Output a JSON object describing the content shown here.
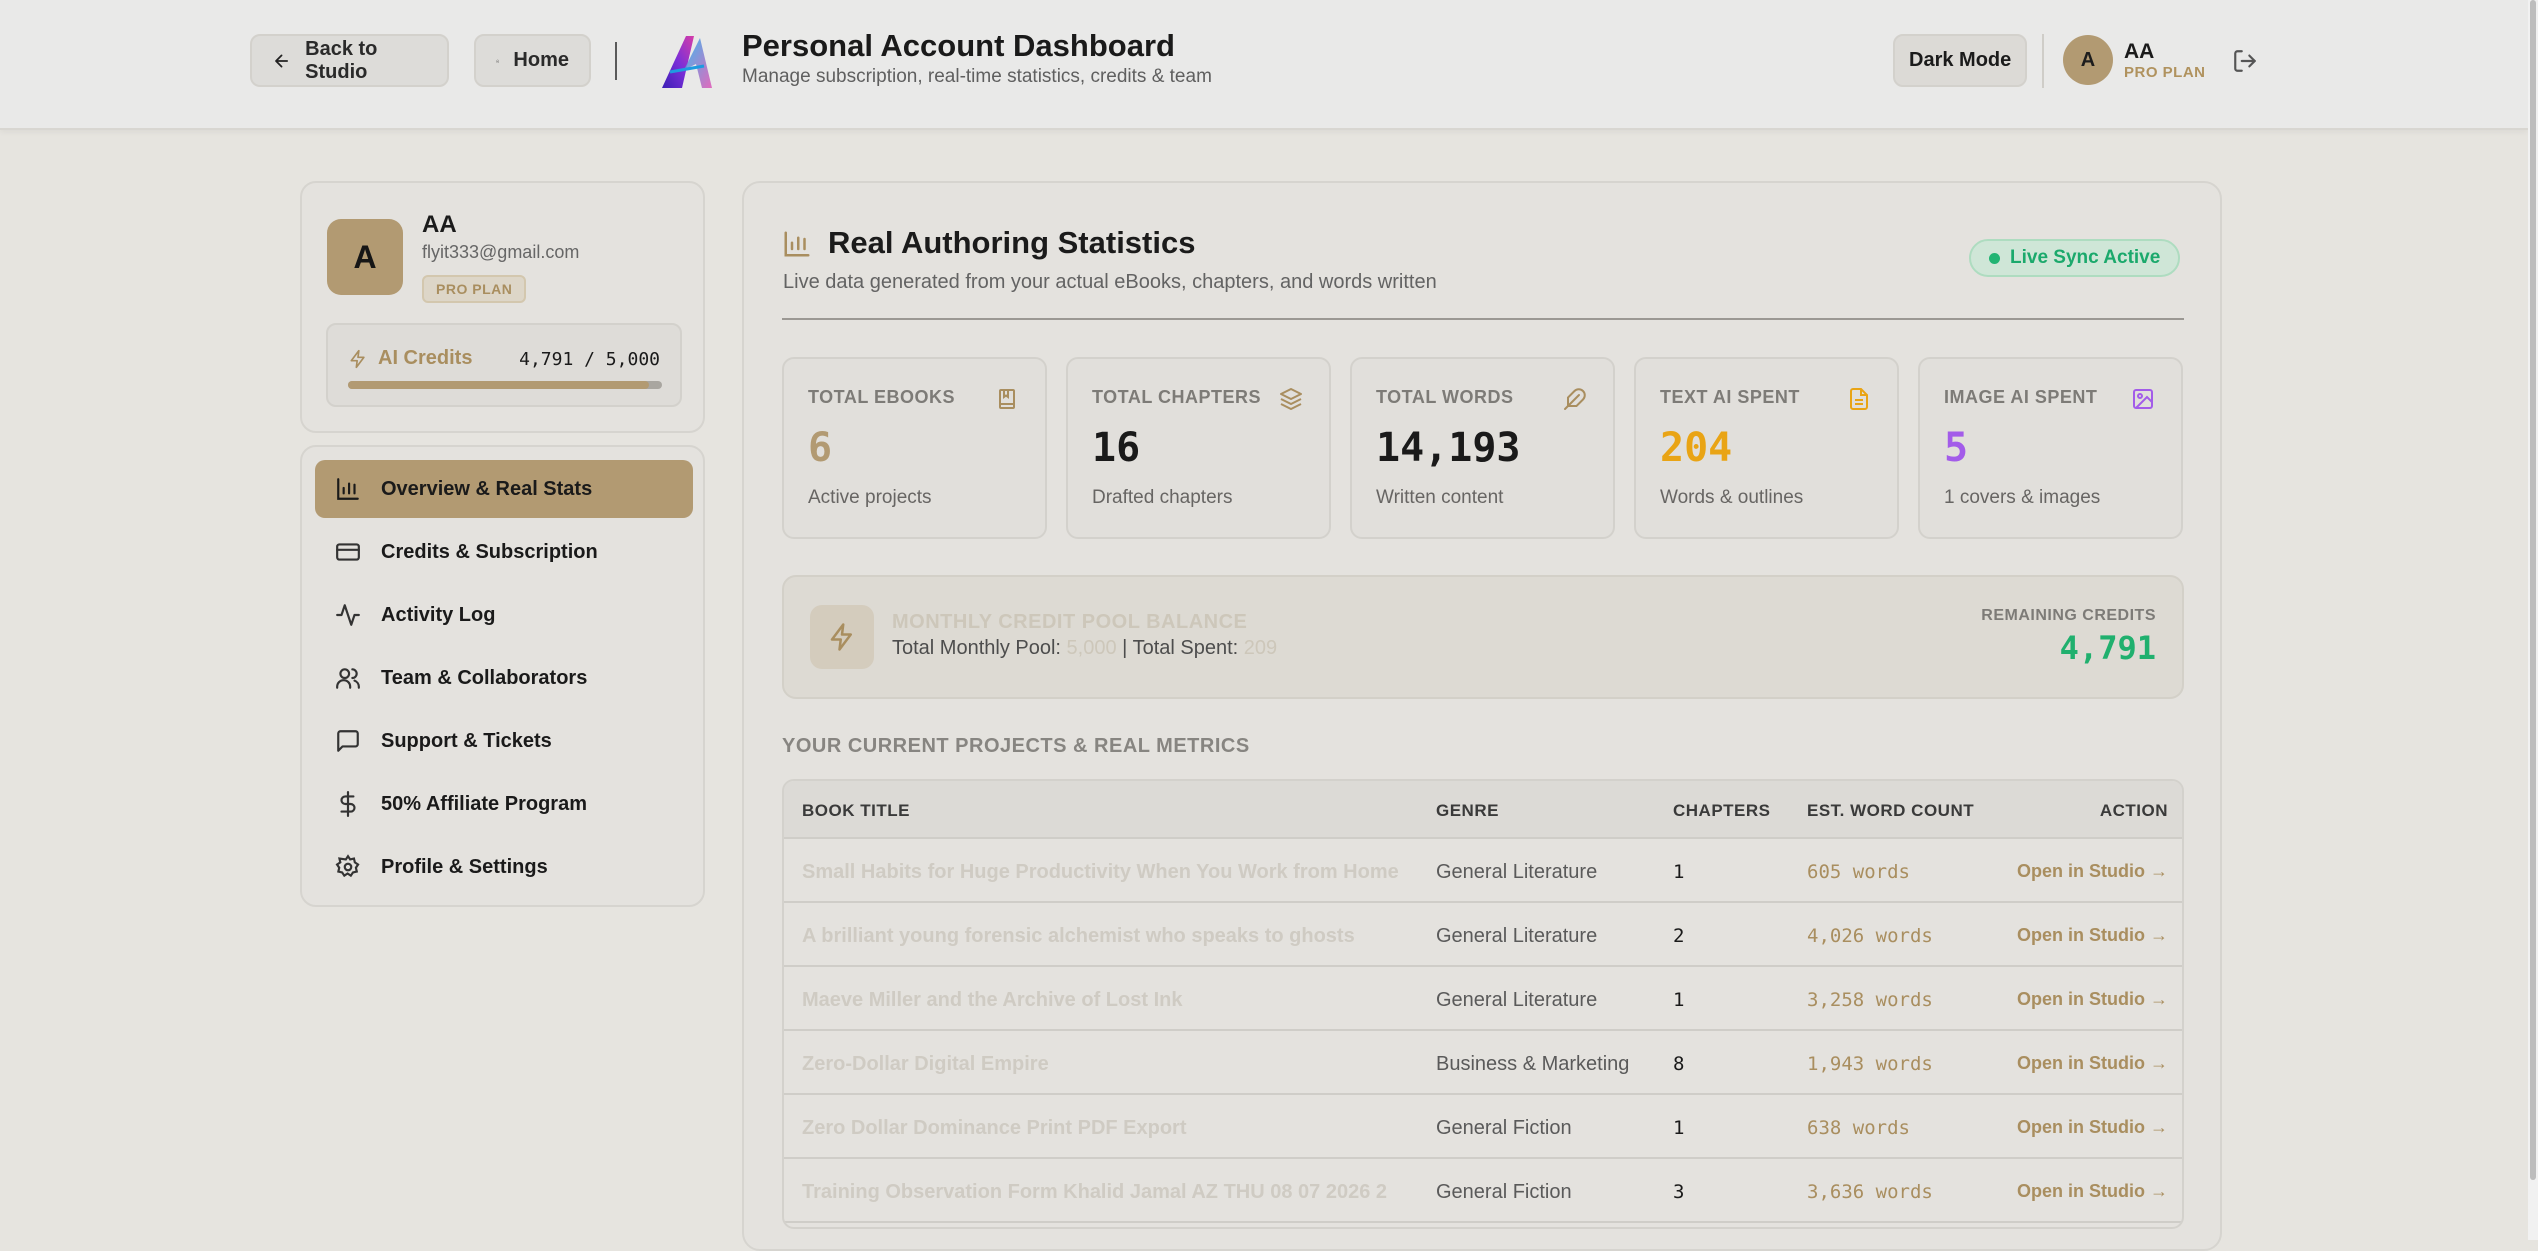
{
  "header": {
    "back_label": "Back to Studio",
    "home_label": "Home",
    "title": "Personal Account Dashboard",
    "subtitle": "Manage subscription, real-time statistics, credits & team",
    "dark_mode_label": "Dark Mode",
    "user_initial": "A",
    "user_name": "AA",
    "user_plan": "PRO PLAN"
  },
  "profile": {
    "initial": "A",
    "name": "AA",
    "email": "flyit333@gmail.com",
    "plan": "PRO PLAN",
    "credits_label": "AI Credits",
    "credits_value": "4,791 / 5,000",
    "credits_fraction": 0.958
  },
  "nav": {
    "items": [
      {
        "label": "Overview & Real Stats",
        "icon": "bar-chart-icon",
        "active": true
      },
      {
        "label": "Credits & Subscription",
        "icon": "credit-card-icon",
        "active": false
      },
      {
        "label": "Activity Log",
        "icon": "activity-icon",
        "active": false
      },
      {
        "label": "Team & Collaborators",
        "icon": "users-icon",
        "active": false
      },
      {
        "label": "Support & Tickets",
        "icon": "message-square-icon",
        "active": false
      },
      {
        "label": "50% Affiliate Program",
        "icon": "dollar-icon",
        "active": false
      },
      {
        "label": "Profile & Settings",
        "icon": "gear-icon",
        "active": false
      }
    ]
  },
  "main": {
    "title": "Real Authoring Statistics",
    "subtitle": "Live data generated from your actual eBooks, chapters, and words written",
    "live_label": "Live Sync Active",
    "stats": [
      {
        "label": "TOTAL EBOOKS",
        "value": "6",
        "desc": "Active projects",
        "color": "#b29a72",
        "icon": "book-icon"
      },
      {
        "label": "TOTAL CHAPTERS",
        "value": "16",
        "desc": "Drafted chapters",
        "color": "#1a1a1a",
        "icon": "layers-icon"
      },
      {
        "label": "TOTAL WORDS",
        "value": "14,193",
        "desc": "Written content",
        "color": "#1a1a1a",
        "icon": "feather-icon"
      },
      {
        "label": "TEXT AI SPENT",
        "value": "204",
        "desc": "Words & outlines",
        "color": "#e9a415",
        "icon": "file-text-icon"
      },
      {
        "label": "IMAGE AI SPENT",
        "value": "5",
        "desc": "1 covers & images",
        "color": "#a35ce9",
        "icon": "image-icon"
      }
    ],
    "pool": {
      "title": "MONTHLY CREDIT POOL BALANCE",
      "pool_label": "Total Monthly Pool:",
      "pool_value": "5,000",
      "separator": "|",
      "spent_label": "Total Spent:",
      "spent_value": "209",
      "remaining_label": "REMAINING CREDITS",
      "remaining_value": "4,791"
    },
    "projects_heading": "YOUR CURRENT PROJECTS & REAL METRICS",
    "table": {
      "headers": [
        "BOOK TITLE",
        "GENRE",
        "CHAPTERS",
        "EST. WORD COUNT",
        "ACTION"
      ],
      "rows": [
        {
          "title": "Small Habits for Huge Productivity When You Work from Home",
          "genre": "General Literature",
          "chapters": "1",
          "words": "605 words",
          "action": "Open in Studio →"
        },
        {
          "title": "A brilliant young forensic alchemist who speaks to ghosts",
          "genre": "General Literature",
          "chapters": "2",
          "words": "4,026 words",
          "action": "Open in Studio →"
        },
        {
          "title": "Maeve Miller and the Archive of Lost Ink",
          "genre": "General Literature",
          "chapters": "1",
          "words": "3,258 words",
          "action": "Open in Studio →"
        },
        {
          "title": "Zero-Dollar Digital Empire",
          "genre": "Business & Marketing",
          "chapters": "8",
          "words": "1,943 words",
          "action": "Open in Studio →"
        },
        {
          "title": "Zero Dollar Dominance Print PDF Export",
          "genre": "General Fiction",
          "chapters": "1",
          "words": "638 words",
          "action": "Open in Studio →"
        },
        {
          "title": "Training Observation Form Khalid Jamal AZ THU 08 07 2026 2",
          "genre": "General Fiction",
          "chapters": "3",
          "words": "3,636 words",
          "action": "Open in Studio →"
        }
      ]
    }
  }
}
